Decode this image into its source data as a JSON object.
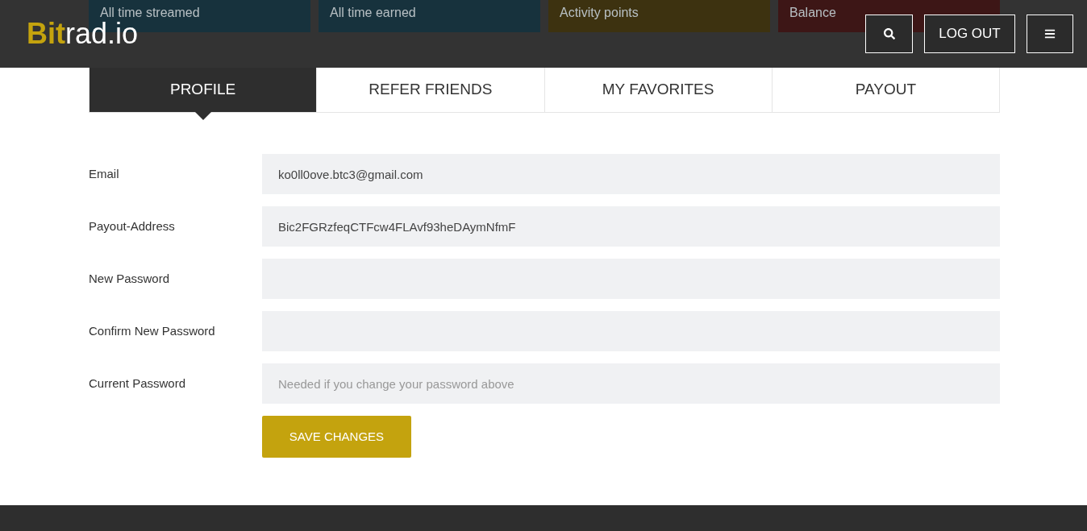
{
  "stats": [
    {
      "label": "All time streamed",
      "color": "#17323d"
    },
    {
      "label": "All time earned",
      "color": "#17323d"
    },
    {
      "label": "Activity points",
      "color": "#3d3210"
    },
    {
      "label": "Balance",
      "color": "#3d1616"
    }
  ],
  "header": {
    "logo_accent": "Bit",
    "logo_rest": "rad.io",
    "logout": "LOG OUT"
  },
  "tabs": [
    {
      "label": "PROFILE",
      "selected": true
    },
    {
      "label": "REFER FRIENDS",
      "selected": false
    },
    {
      "label": "MY FAVORITES",
      "selected": false
    },
    {
      "label": "PAYOUT",
      "selected": false
    }
  ],
  "form": {
    "fields": [
      {
        "label": "Email",
        "value": "ko0ll0ove.btc3@gmail.com"
      },
      {
        "label": "Payout-Address",
        "value": "Bic2FGRzfeqCTFcw4FLAvf93heDAymNfmF"
      },
      {
        "label": "New Password"
      },
      {
        "label": "Confirm New Password"
      },
      {
        "label": "Current Password",
        "placeholder": "Needed if you change your password above"
      }
    ],
    "submit": "SAVE CHANGES"
  }
}
